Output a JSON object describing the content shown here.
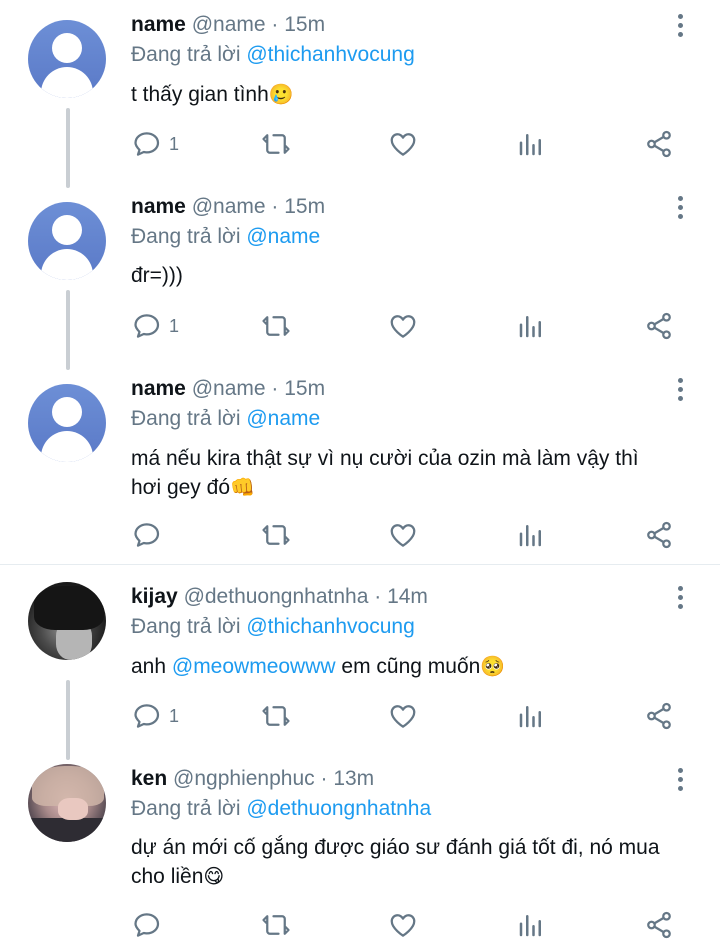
{
  "tweets": [
    {
      "avatar": "default-avatar",
      "name": "name",
      "handle": "@name",
      "dot": "·",
      "time": "15m",
      "reply_prefix": "Đang trả lời",
      "reply_to": "@thichanhvocung",
      "text": "t thấy gian tình",
      "emoji": "🥲",
      "reply_count": "1"
    },
    {
      "avatar": "default-avatar",
      "name": "name",
      "handle": "@name",
      "dot": "·",
      "time": "15m",
      "reply_prefix": "Đang trả lời",
      "reply_to": "@name",
      "text": "đr=)))",
      "reply_count": "1"
    },
    {
      "avatar": "default-avatar",
      "name": "name",
      "handle": "@name",
      "dot": "·",
      "time": "15m",
      "reply_prefix": "Đang trả lời",
      "reply_to": "@name",
      "text_line1": "má nếu kira thật sự vì nụ cười của ozin mà làm vậy thì",
      "text_line2": "hơi gey đó",
      "emoji": "👊",
      "reply_count": ""
    },
    {
      "avatar": "photo-avatar",
      "name": "kijay",
      "handle": "@dethuongnhatnha",
      "dot": "·",
      "time": "14m",
      "reply_prefix": "Đang trả lời",
      "reply_to": "@thichanhvocung",
      "text_pre": "anh ",
      "text_mention": "@meowmeowww",
      "text_post": " em cũng muốn",
      "emoji": "🥺",
      "reply_count": "1"
    },
    {
      "avatar": "photo-avatar",
      "name": "ken",
      "handle": "@ngphienphuc",
      "dot": "·",
      "time": "13m",
      "reply_prefix": "Đang trả lời",
      "reply_to": "@dethuongnhatnha",
      "text_line1": "dự án mới cố gắng được giáo sư đánh giá tốt đi, nó mua",
      "text_line2": "cho liền",
      "emoji": "😋",
      "reply_count": ""
    }
  ],
  "icons": {
    "reply": "reply-icon",
    "retweet": "retweet-icon",
    "like": "heart-icon",
    "analytics": "analytics-icon",
    "share": "share-icon",
    "more": "more-vertical-icon"
  },
  "colors": {
    "link": "#1d9bf0",
    "secondary": "#657786",
    "text": "#0f1419",
    "avatar_blue": "#5a79c7",
    "thread_line": "#c9ced3"
  }
}
